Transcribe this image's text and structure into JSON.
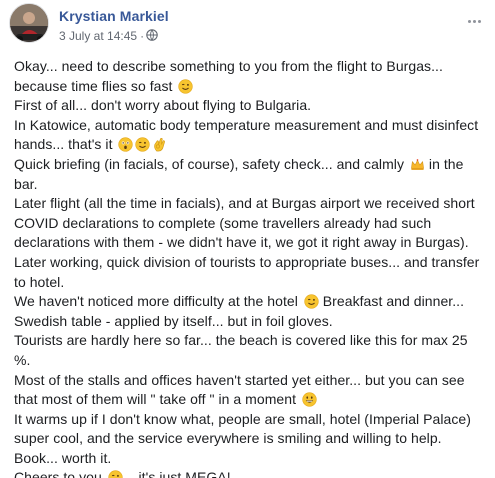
{
  "post": {
    "author": "Krystian Markiel",
    "timestamp": "3 July at 14:45",
    "separator": "·",
    "icons": {
      "avatar": "profile-photo",
      "privacy": "globe-icon",
      "menu": "more-options-icon"
    },
    "colors": {
      "author": "#385898",
      "text": "#1c1e21",
      "meta": "#616770"
    },
    "lines": [
      "Okay... need to describe something to you from the flight to Burgas...",
      "because time flies so fast",
      "First of all... don't worry about flying to Bulgaria.",
      "In Katowice, automatic body temperature measurement and must disinfect",
      "hands... that's it",
      "Quick briefing (in facials, of course), safety check... and calmly",
      "bar.",
      "Later flight (all the time in facials), and at Burgas airport we received short",
      "COVID declarations to complete (some travellers already had such",
      "declarations with them - we didn't have it, we got it right away in Burgas).",
      "Later working, quick division of tourists to appropriate buses... and transfer",
      "to hotel.",
      "We haven't noticed more difficulty at the hotel",
      "Swedish table - applied by itself... but in foil gloves.",
      "Tourists are hardly here so far... the beach is covered like this for max 25",
      "%.",
      "Most of the stalls and offices haven't started yet either... but you can see",
      "that most of them will \" take off \" in a moment",
      "It warms up if I don't know what, people are small, hotel (Imperial Palace)",
      "super cool, and the service everywhere is smiling and willing to help.",
      "Book... worth it.",
      "Cheers to you"
    ],
    "inline_after": {
      "line6_tail": "in the",
      "line13_tail": "Breakfast and dinner...",
      "line22_tail": "... it's just MEGA!"
    }
  }
}
